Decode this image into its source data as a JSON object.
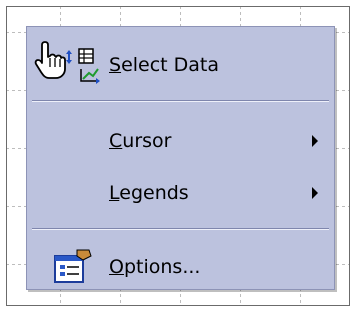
{
  "menu": {
    "items": [
      {
        "pre": "",
        "underline": "S",
        "post": "elect Data",
        "icon": "select-data-icon",
        "submenu": false
      },
      {
        "pre": "",
        "underline": "C",
        "post": "ursor",
        "icon": "",
        "submenu": true
      },
      {
        "pre": "",
        "underline": "L",
        "post": "egends",
        "icon": "",
        "submenu": true
      },
      {
        "pre": "",
        "underline": "O",
        "post": "ptions...",
        "icon": "options-icon",
        "submenu": false
      }
    ]
  },
  "colors": {
    "menu_bg": "#bcc2de",
    "menu_border": "#8d93b6",
    "separator": "#7f86ad"
  },
  "cursor": "hand-pointer-icon"
}
